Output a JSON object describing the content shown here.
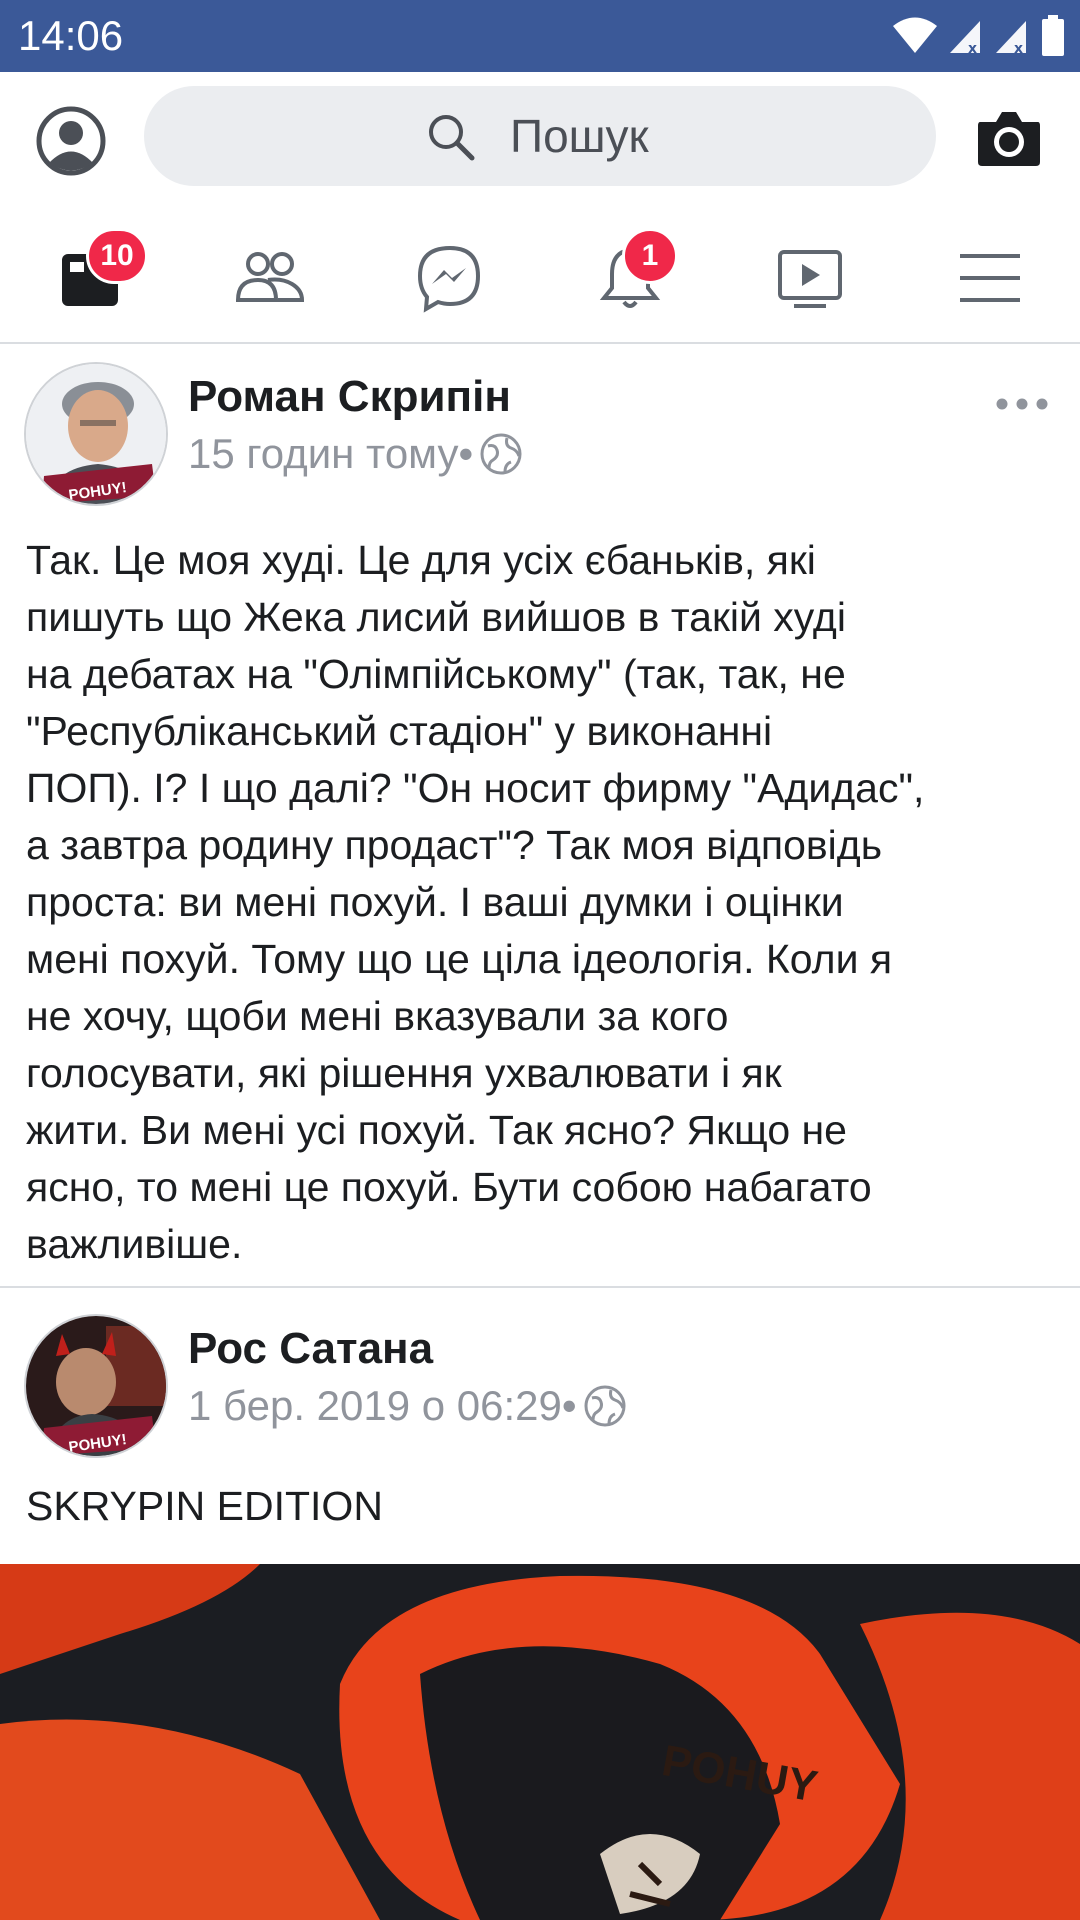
{
  "status_bar": {
    "time": "14:06",
    "icons": [
      "wifi-icon",
      "signal-icon",
      "signal-icon",
      "battery-icon"
    ]
  },
  "search": {
    "placeholder": "Пошук",
    "left_icon": "profile-icon",
    "right_icon": "camera-icon"
  },
  "nav": {
    "tabs": [
      {
        "name": "news-feed",
        "icon": "news-feed-icon",
        "badge": "10"
      },
      {
        "name": "friends",
        "icon": "friends-icon",
        "badge": ""
      },
      {
        "name": "messenger",
        "icon": "messenger-icon",
        "badge": ""
      },
      {
        "name": "notifications",
        "icon": "bell-icon",
        "badge": "1"
      },
      {
        "name": "watch",
        "icon": "video-icon",
        "badge": ""
      },
      {
        "name": "menu",
        "icon": "menu-icon",
        "badge": ""
      }
    ]
  },
  "posts": [
    {
      "author": "Роман Скрипін",
      "time": "15 годин тому",
      "separator": "•",
      "privacy_icon": "globe-icon",
      "avatar_label": "POHUY!",
      "text_lines": [
        "Так. Це моя худі. Це для усіх єбаньків, які",
        "пишуть що Жека лисий вийшов в такій худі",
        "на дебатах на \"Олімпійському\" (так, так, не",
        "\"Республіканський стадіон\" у виконанні",
        "ПОП). І? І що далі? \"Он носит фирму \"Адидас\",",
        "а завтра родину продаст\"? Так моя відповідь",
        "проста: ви мені похуй. І ваші думки і оцінки",
        "мені похуй. Тому що це ціла ідеологія. Коли я",
        "не хочу, щоби мені вказували за кого",
        "голосувати, які рішення ухвалювати і як",
        "жити. Ви мені усі похуй. Так ясно? Якщо не",
        "ясно, то мені  це похуй. Бути собою набагато",
        "важливіше."
      ]
    },
    {
      "author": "Рос Сатана",
      "time": "1 бер. 2019 о 06:29",
      "separator": "•",
      "privacy_icon": "globe-icon",
      "avatar_label": "POHUY!",
      "text": "SKRYPIN EDITION",
      "image_label": "POHUY"
    }
  ],
  "colors": {
    "status_bar": "#3b5998",
    "badge": "#f02849",
    "meta_text": "#90949c",
    "icon_gray": "#606770",
    "search_bg": "#ebedf0",
    "hoodie": "#e8431b"
  }
}
